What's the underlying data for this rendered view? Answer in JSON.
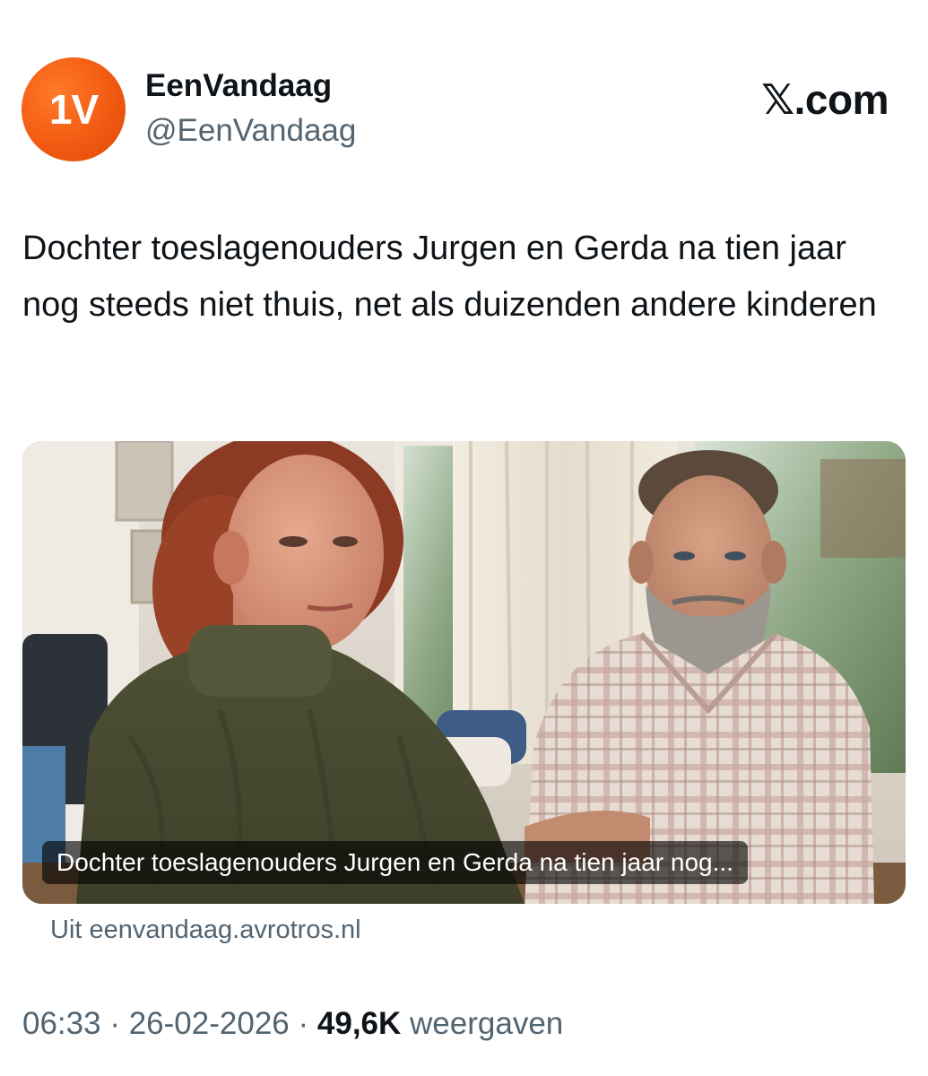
{
  "author": {
    "avatar_text": "1V",
    "display_name": "EenVandaag",
    "handle": "@EenVandaag"
  },
  "platform": {
    "label": "𝕏.com"
  },
  "tweet": {
    "text": "Dochter toeslagenouders Jurgen en Gerda na tien jaar nog steeds niet thuis, net als duizenden andere kinderen"
  },
  "card": {
    "caption": "Dochter toeslagenouders Jurgen en Gerda na tien jaar nog...",
    "source": "Uit eenvandaag.avrotros.nl"
  },
  "meta": {
    "time": "06:33",
    "separator": "·",
    "date": "26-02-2026",
    "views": "49,6K",
    "views_label": "weergaven"
  },
  "colors": {
    "brand_orange": "#f25a12",
    "text_primary": "#0f1419",
    "text_secondary": "#536471"
  }
}
